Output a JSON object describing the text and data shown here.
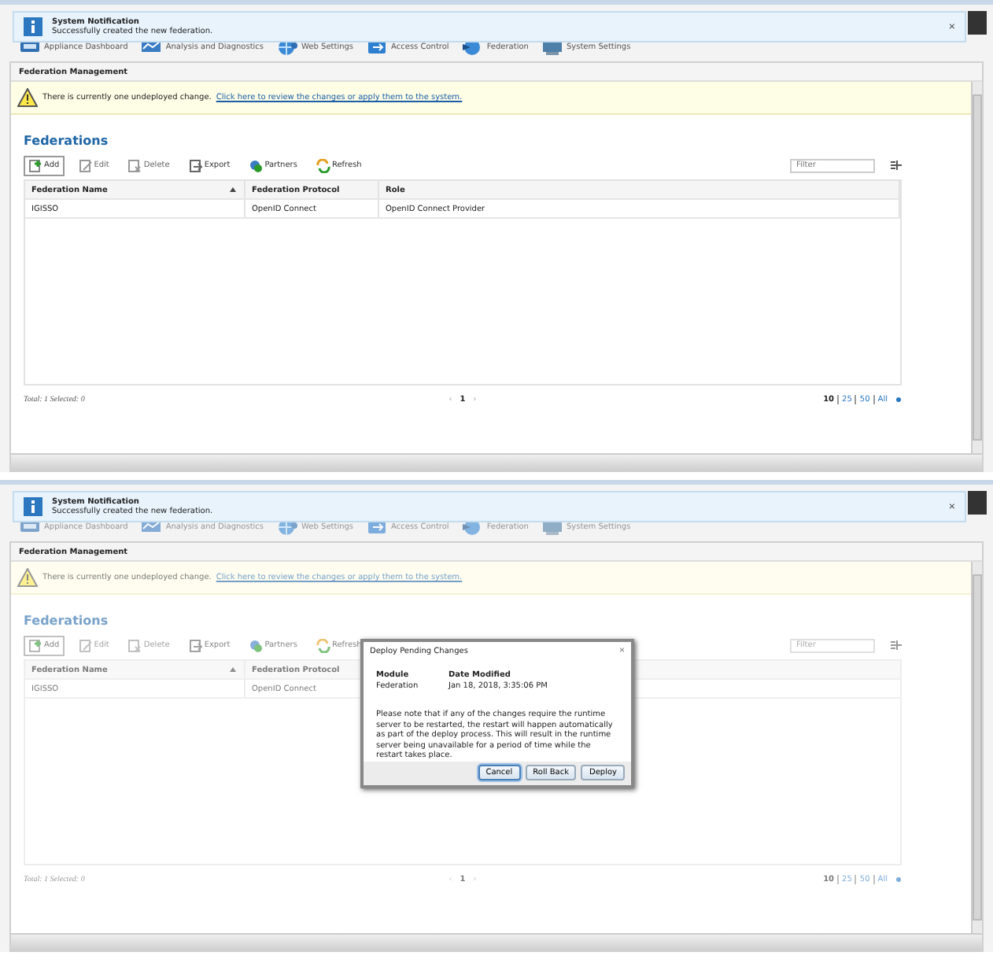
{
  "screens": [
    {
      "dimmed": false,
      "notification": {
        "title": "System Notification",
        "message": "Successfully created the new federation.",
        "close": "×"
      },
      "nav": [
        "Appliance Dashboard",
        "Analysis and Diagnostics",
        "Web Settings",
        "Access Control",
        "Federation",
        "System Settings"
      ],
      "panel_title": "Federation Management",
      "warning": {
        "text": "There is currently one undeployed change.",
        "link": "Click here to review the changes or apply them to the system."
      },
      "section_title": "Federations",
      "toolbar": [
        {
          "label": "Add",
          "disabled": false
        },
        {
          "label": "Edit",
          "disabled": true
        },
        {
          "label": "Delete",
          "disabled": true
        },
        {
          "label": "Export",
          "disabled": false
        },
        {
          "label": "Partners",
          "disabled": false
        },
        {
          "label": "Refresh",
          "disabled": false
        }
      ],
      "filter": {
        "placeholder": "Filter"
      },
      "table": {
        "columns": [
          "Federation Name",
          "Federation Protocol",
          "Role"
        ],
        "rows": [
          [
            "IGISSO",
            "OpenID Connect",
            "OpenID Connect Provider"
          ]
        ]
      },
      "footer": {
        "summary": "Total: 1 Selected: 0",
        "prev": "‹",
        "page": "1",
        "next": "›",
        "page_sizes": [
          {
            "label": "10",
            "selected": true
          },
          {
            "label": "25",
            "selected": false
          },
          {
            "label": "50",
            "selected": false
          },
          {
            "label": "All",
            "selected": false
          }
        ]
      }
    },
    {
      "dimmed": true,
      "notification": {
        "title": "System Notification",
        "message": "Successfully created the new federation.",
        "close": "×"
      },
      "nav": [
        "Appliance Dashboard",
        "Analysis and Diagnostics",
        "Web Settings",
        "Access Control",
        "Federation",
        "System Settings"
      ],
      "panel_title": "Federation Management",
      "warning": {
        "text": "There is currently one undeployed change.",
        "link": "Click here to review the changes or apply them to the system."
      },
      "section_title": "Federations",
      "toolbar": [
        {
          "label": "Add",
          "disabled": false
        },
        {
          "label": "Edit",
          "disabled": true
        },
        {
          "label": "Delete",
          "disabled": true
        },
        {
          "label": "Export",
          "disabled": false
        },
        {
          "label": "Partners",
          "disabled": false
        },
        {
          "label": "Refresh",
          "disabled": false
        }
      ],
      "filter": {
        "placeholder": "Filter"
      },
      "table": {
        "columns": [
          "Federation Name",
          "Federation Protocol"
        ],
        "rows": [
          [
            "IGISSO",
            "OpenID Connect"
          ]
        ]
      },
      "footer": {
        "summary": "Total: 1 Selected: 0",
        "prev": "‹",
        "page": "1",
        "next": "›",
        "page_sizes": [
          {
            "label": "10",
            "selected": true
          },
          {
            "label": "25",
            "selected": false
          },
          {
            "label": "50",
            "selected": false
          },
          {
            "label": "All",
            "selected": false
          }
        ]
      },
      "dialog": {
        "title": "Deploy Pending Changes",
        "close": "×",
        "columns": [
          "Module",
          "Date Modified"
        ],
        "row": [
          "Federation",
          "Jan 18, 2018, 3:35:06 PM"
        ],
        "message": "Please note that if any of the changes require the runtime server to be restarted, the restart will happen automatically as part of the deploy process. This will result in the runtime server being unavailable for a period of time while the restart takes place.",
        "buttons": [
          {
            "label": "Cancel",
            "focused": true
          },
          {
            "label": "Roll Back",
            "focused": false
          },
          {
            "label": "Deploy",
            "focused": false
          }
        ]
      }
    }
  ]
}
